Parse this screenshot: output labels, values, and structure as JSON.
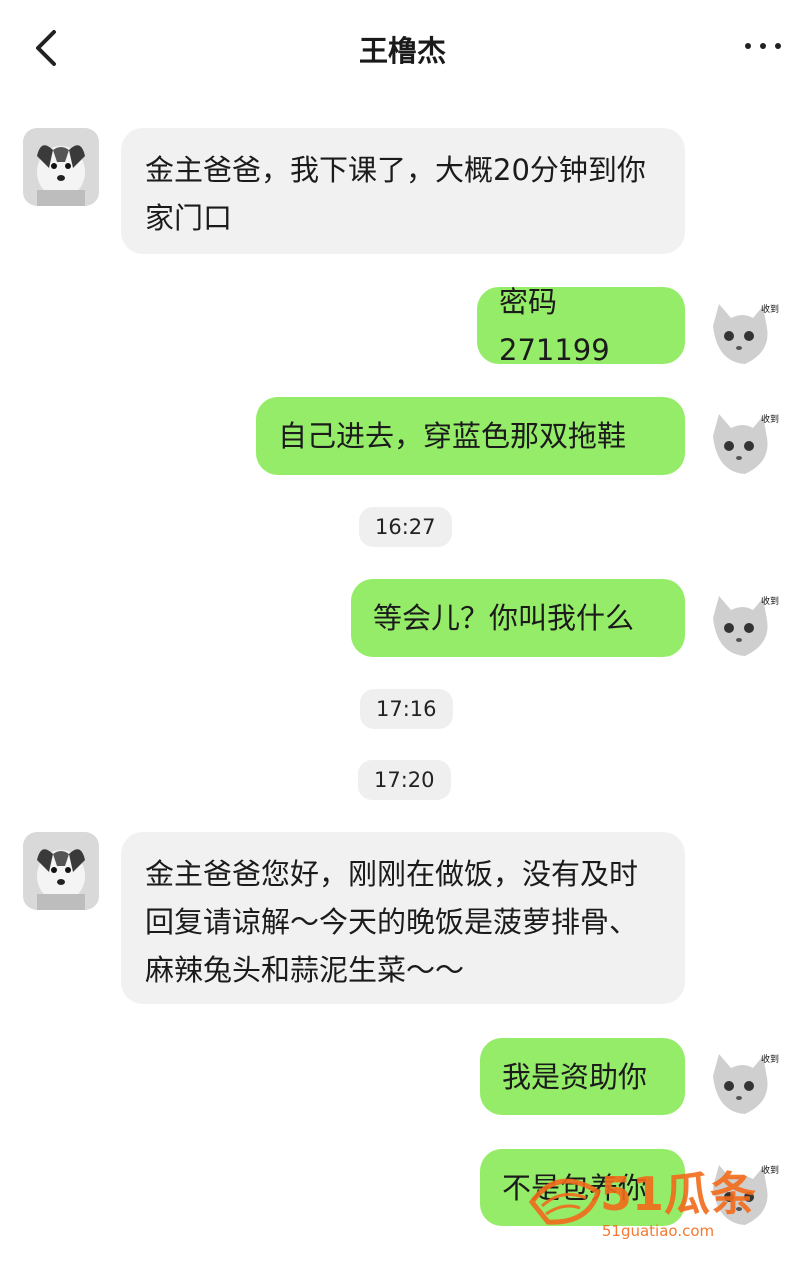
{
  "header": {
    "title": "王橹杰",
    "back_icon": "chevron-left-icon",
    "more_icon": "more-horizontal-icon"
  },
  "sticker_text": "收到",
  "messages": [
    {
      "type": "in",
      "text": "金主爸爸，我下课了，大概20分钟到你家门口"
    },
    {
      "type": "out",
      "text": "密码271199"
    },
    {
      "type": "out",
      "text": "自己进去，穿蓝色那双拖鞋"
    },
    {
      "type": "time",
      "text": "16:27"
    },
    {
      "type": "out",
      "text": "等会儿？你叫我什么"
    },
    {
      "type": "time",
      "text": "17:16"
    },
    {
      "type": "time",
      "text": "17:20"
    },
    {
      "type": "in",
      "text": "金主爸爸您好，刚刚在做饭，没有及时回复请谅解～今天的晚饭是菠萝排骨、麻辣兔头和蒜泥生菜～～"
    },
    {
      "type": "out",
      "text": "我是资助你"
    },
    {
      "type": "out",
      "text": "不是包养你"
    }
  ],
  "watermark": {
    "brand": "51瓜条",
    "url": "51guatiao.com"
  },
  "colors": {
    "outgoing_bubble": "#95ec69",
    "incoming_bubble": "#f1f1f1",
    "watermark": "#f26a1b"
  }
}
